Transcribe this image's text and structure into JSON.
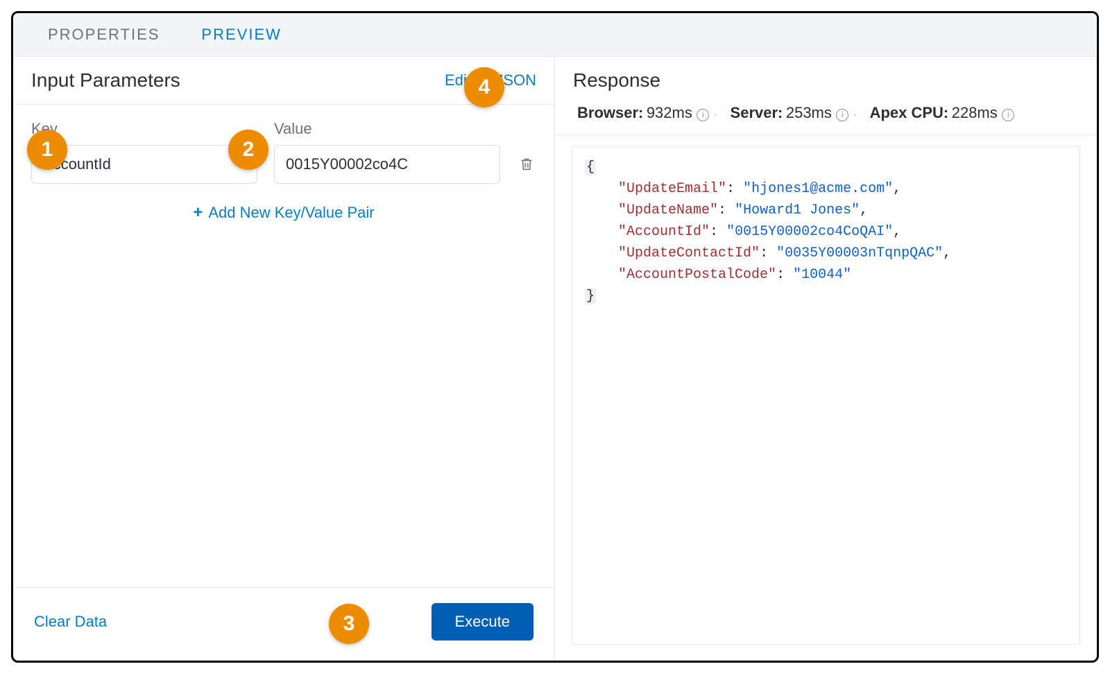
{
  "tabs": {
    "properties": "PROPERTIES",
    "preview": "PREVIEW"
  },
  "left": {
    "title": "Input Parameters",
    "edit_json": "Edit as JSON",
    "key_label": "Key",
    "value_label": "Value",
    "key_value": "AccountId",
    "val_value": "0015Y00002co4C",
    "add_pair": "Add New Key/Value Pair",
    "clear": "Clear Data",
    "execute": "Execute"
  },
  "right": {
    "title": "Response",
    "browser_label": "Browser:",
    "browser_val": "932ms",
    "server_label": "Server:",
    "server_val": "253ms",
    "apex_label": "Apex CPU:",
    "apex_val": "228ms"
  },
  "json": {
    "k1": "\"UpdateEmail\"",
    "v1": "\"hjones1@acme.com\"",
    "k2": "\"UpdateName\"",
    "v2": "\"Howard1 Jones\"",
    "k3": "\"AccountId\"",
    "v3": "\"0015Y00002co4CoQAI\"",
    "k4": "\"UpdateContactId\"",
    "v4": "\"0035Y00003nTqnpQAC\"",
    "k5": "\"AccountPostalCode\"",
    "v5": "\"10044\""
  },
  "callouts": {
    "c1": "1",
    "c2": "2",
    "c3": "3",
    "c4": "4"
  }
}
